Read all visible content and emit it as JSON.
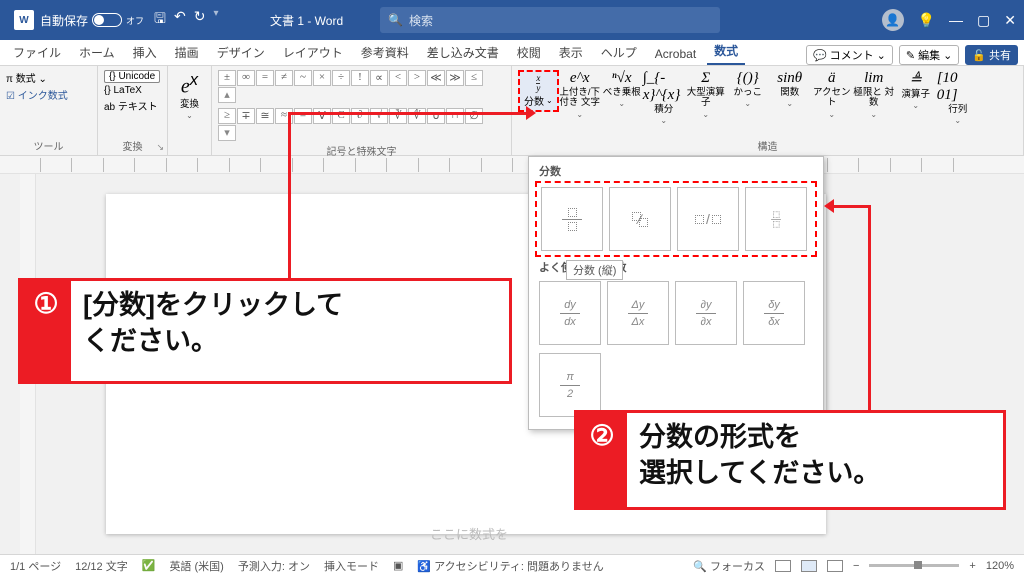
{
  "titlebar": {
    "autosave_label": "自動保存",
    "autosave_state": "オフ",
    "doc_title": "文書 1 - Word",
    "search_placeholder": "検索"
  },
  "tabs": {
    "items": [
      "ファイル",
      "ホーム",
      "挿入",
      "描画",
      "デザイン",
      "レイアウト",
      "参考資料",
      "差し込み文書",
      "校閲",
      "表示",
      "ヘルプ",
      "Acrobat",
      "数式"
    ],
    "active_index": 12,
    "comment": "コメント",
    "edit": "編集",
    "share": "共有"
  },
  "ribbon": {
    "group_tool": "ツール",
    "tool": {
      "eq": "数式",
      "unicode": "{} Unicode",
      "latex": "LaTeX",
      "text": "テキスト",
      "ink": "インク数式"
    },
    "group_convert": "変換",
    "convert_label": "変換",
    "group_symbols": "記号と特殊文字",
    "symbols_row1": [
      "±",
      "∞",
      "=",
      "≠",
      "~",
      "×",
      "÷",
      "!",
      "∝",
      "<",
      ">",
      "≪",
      "≫",
      "≤"
    ],
    "symbols_row2": [
      "≥",
      "∓",
      "≅",
      "≈",
      "≡",
      "∀",
      "C",
      "∂",
      "√",
      "∛",
      "∜",
      "∪",
      "∩",
      "∅"
    ],
    "group_structures": "構造",
    "fraction": "分数",
    "structures": [
      {
        "icon": "e^x",
        "label": "上付き/下付き\n文字"
      },
      {
        "icon": "ⁿ√x",
        "label": "べき乗根"
      },
      {
        "icon": "∫_{-x}^{x}",
        "label": "積分"
      },
      {
        "icon": "Σ",
        "label": "大型演算子"
      },
      {
        "icon": "{()}",
        "label": "かっこ"
      },
      {
        "icon": "sinθ",
        "label": "関数"
      },
      {
        "icon": "ä",
        "label": "アクセント"
      },
      {
        "icon": "lim",
        "label": "極限と\n対数"
      },
      {
        "icon": "≜",
        "label": "演算子"
      },
      {
        "icon": "[10\n01]",
        "label": "行列"
      }
    ]
  },
  "dropdown": {
    "section1": "分数",
    "section2": "よく使われる分数",
    "tooltip": "分数 (縦)",
    "common": [
      "dy/dx",
      "Δy/Δx",
      "∂y/∂x",
      "δy/δx"
    ],
    "pi2_num": "π",
    "pi2_den": "2"
  },
  "callout1": {
    "num": "①",
    "line1": "[分数]をクリックして",
    "line2": "ください。"
  },
  "callout2": {
    "num": "②",
    "line1": "分数の形式を",
    "line2": "選択してください。"
  },
  "page_hint": "ここに数式を",
  "status": {
    "page": "1/1 ページ",
    "words": "12/12 文字",
    "lang": "英語 (米国)",
    "predict": "予測入力: オン",
    "insert": "挿入モード",
    "access": "アクセシビリティ: 問題ありません",
    "focus": "フォーカス",
    "zoom": "120%"
  }
}
